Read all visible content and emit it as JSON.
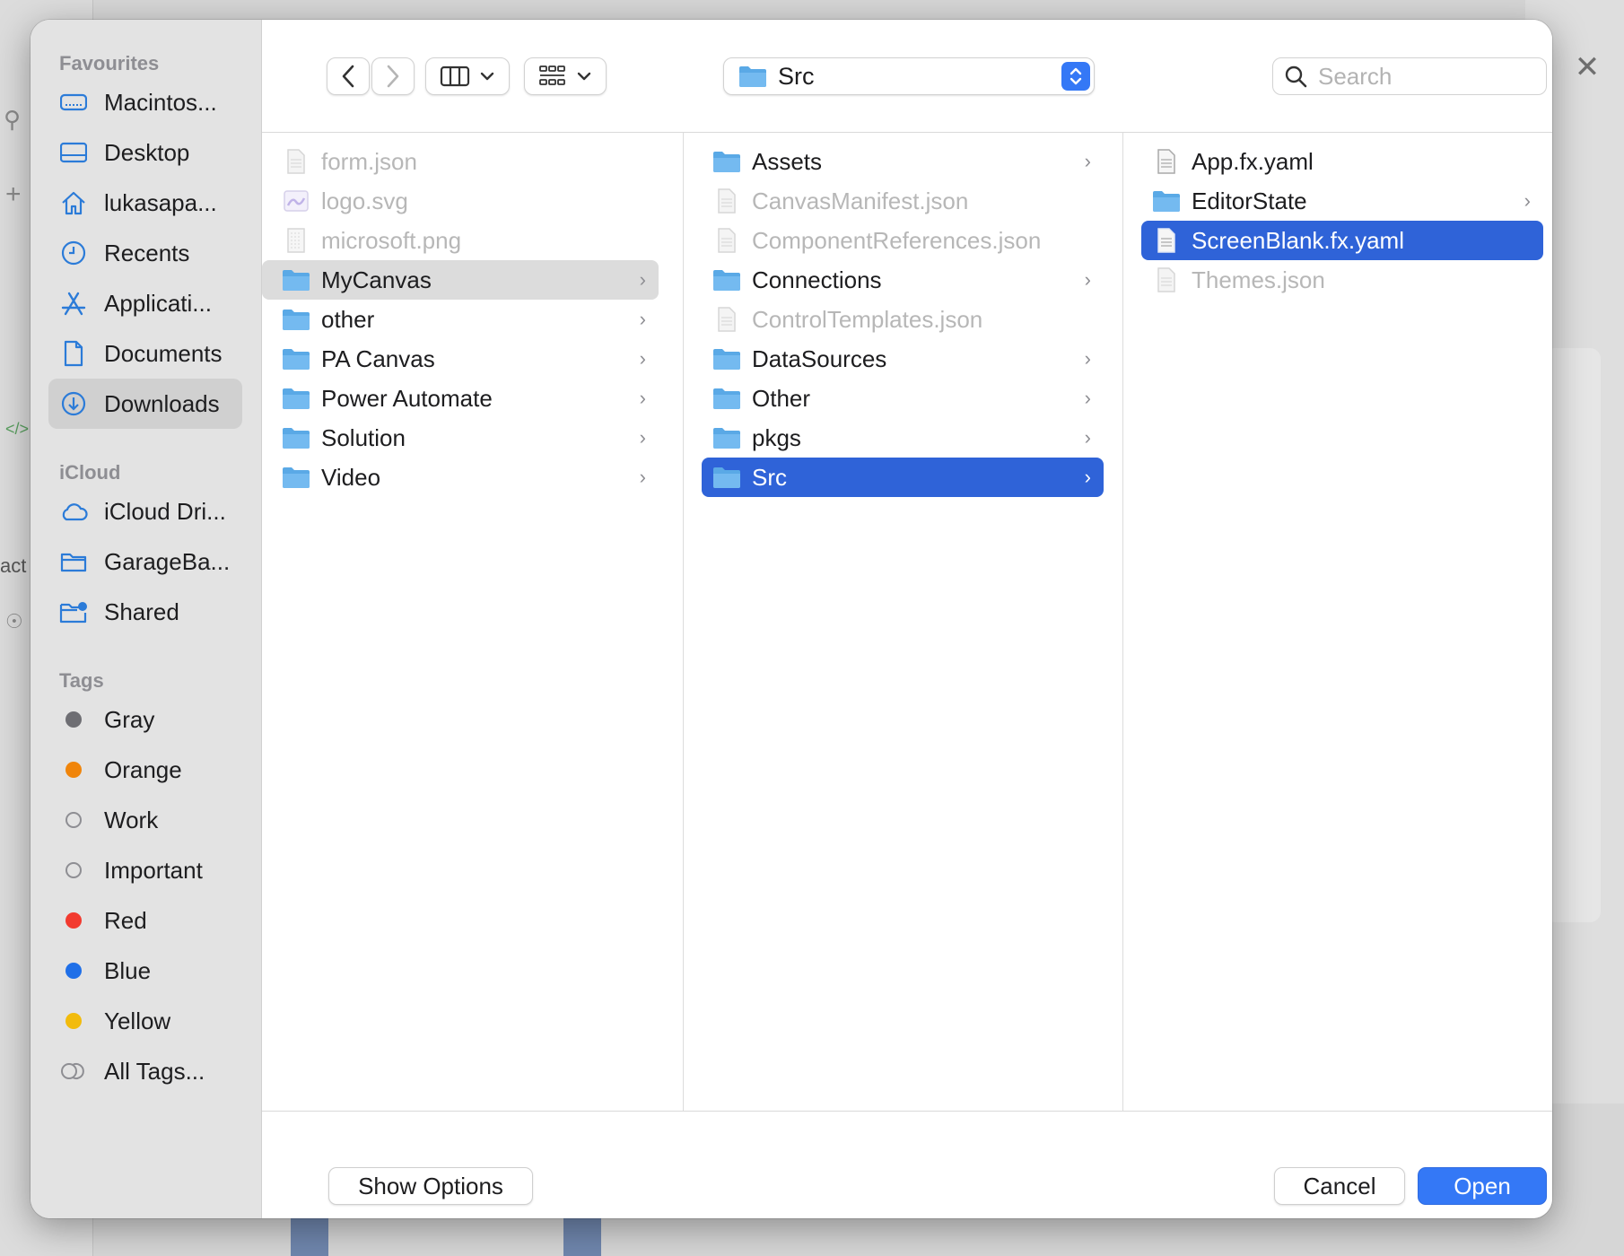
{
  "background": {
    "partial_label": "act"
  },
  "sidebar": {
    "favourites_heading": "Favourites",
    "favourites": [
      {
        "label": "Macintos...",
        "icon": "disk-icon"
      },
      {
        "label": "Desktop",
        "icon": "desktop-icon"
      },
      {
        "label": "lukasapa...",
        "icon": "home-icon"
      },
      {
        "label": "Recents",
        "icon": "clock-icon"
      },
      {
        "label": "Applicati...",
        "icon": "applications-icon"
      },
      {
        "label": "Documents",
        "icon": "document-icon"
      },
      {
        "label": "Downloads",
        "icon": "downloads-icon",
        "selected": true
      }
    ],
    "icloud_heading": "iCloud",
    "icloud": [
      {
        "label": "iCloud Dri...",
        "icon": "cloud-icon"
      },
      {
        "label": "GarageBa...",
        "icon": "folder-outline-icon"
      },
      {
        "label": "Shared",
        "icon": "shared-folder-icon"
      }
    ],
    "tags_heading": "Tags",
    "tags": [
      {
        "label": "Gray",
        "color": "#6e6e73"
      },
      {
        "label": "Orange",
        "color": "#f0850b"
      },
      {
        "label": "Work",
        "color": "hollow"
      },
      {
        "label": "Important",
        "color": "hollow"
      },
      {
        "label": "Red",
        "color": "#f23a2f"
      },
      {
        "label": "Blue",
        "color": "#1f6fe8"
      },
      {
        "label": "Yellow",
        "color": "#f2bb0c"
      },
      {
        "label": "All Tags...",
        "color": "all"
      }
    ]
  },
  "toolbar": {
    "path": "Src",
    "search_placeholder": "Search"
  },
  "columns": {
    "col1": [
      {
        "label": "form.json",
        "type": "file",
        "dim": true
      },
      {
        "label": "logo.svg",
        "type": "image",
        "dim": true
      },
      {
        "label": "microsoft.png",
        "type": "image-grid",
        "dim": true
      },
      {
        "label": "MyCanvas",
        "type": "folder",
        "chevron": true,
        "selected": "gray"
      },
      {
        "label": "other",
        "type": "folder",
        "chevron": true
      },
      {
        "label": "PA Canvas",
        "type": "folder",
        "chevron": true
      },
      {
        "label": "Power Automate",
        "type": "folder",
        "chevron": true
      },
      {
        "label": "Solution",
        "type": "folder",
        "chevron": true
      },
      {
        "label": "Video",
        "type": "folder",
        "chevron": true
      }
    ],
    "col2": [
      {
        "label": "Assets",
        "type": "folder",
        "chevron": true
      },
      {
        "label": "CanvasManifest.json",
        "type": "file",
        "dim": true
      },
      {
        "label": "ComponentReferences.json",
        "type": "file",
        "dim": true
      },
      {
        "label": "Connections",
        "type": "folder",
        "chevron": true
      },
      {
        "label": "ControlTemplates.json",
        "type": "file",
        "dim": true
      },
      {
        "label": "DataSources",
        "type": "folder",
        "chevron": true
      },
      {
        "label": "Other",
        "type": "folder",
        "chevron": true
      },
      {
        "label": "pkgs",
        "type": "folder",
        "chevron": true
      },
      {
        "label": "Src",
        "type": "folder",
        "chevron": true,
        "selected": "blue"
      }
    ],
    "col3": [
      {
        "label": "App.fx.yaml",
        "type": "file"
      },
      {
        "label": "EditorState",
        "type": "folder",
        "chevron": true
      },
      {
        "label": "ScreenBlank.fx.yaml",
        "type": "file",
        "selected": "blue"
      },
      {
        "label": "Themes.json",
        "type": "file",
        "dim": true
      }
    ]
  },
  "bottom": {
    "show_options": "Show Options",
    "cancel": "Cancel",
    "open": "Open"
  },
  "colors": {
    "accent": "#3478f6",
    "selection_blue": "#2f63d8",
    "folder_blue": "#5aa9e6"
  }
}
